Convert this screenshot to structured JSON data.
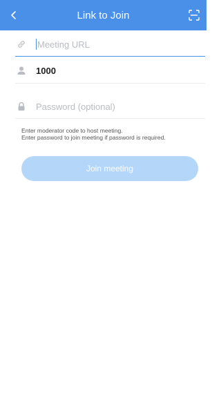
{
  "header": {
    "title": "Link to Join",
    "back_icon": "chevron-left-icon",
    "scan_icon": "scan-icon"
  },
  "form": {
    "url": {
      "placeholder": "Meeting URL",
      "value": "",
      "icon": "link-icon"
    },
    "user": {
      "value": "1000",
      "icon": "user-icon"
    },
    "password": {
      "placeholder": "Password (optional)",
      "value": "",
      "icon": "lock-icon"
    }
  },
  "hint": {
    "line1": "Enter moderator code to host meeting.",
    "line2": "Enter password to join meeting if password is required."
  },
  "join_button": {
    "label": "Join meeting",
    "state": "disabled"
  },
  "colors": {
    "accent": "#4a90e8",
    "button_disabled": "#b4d6f9",
    "placeholder": "#b9bcc0"
  }
}
